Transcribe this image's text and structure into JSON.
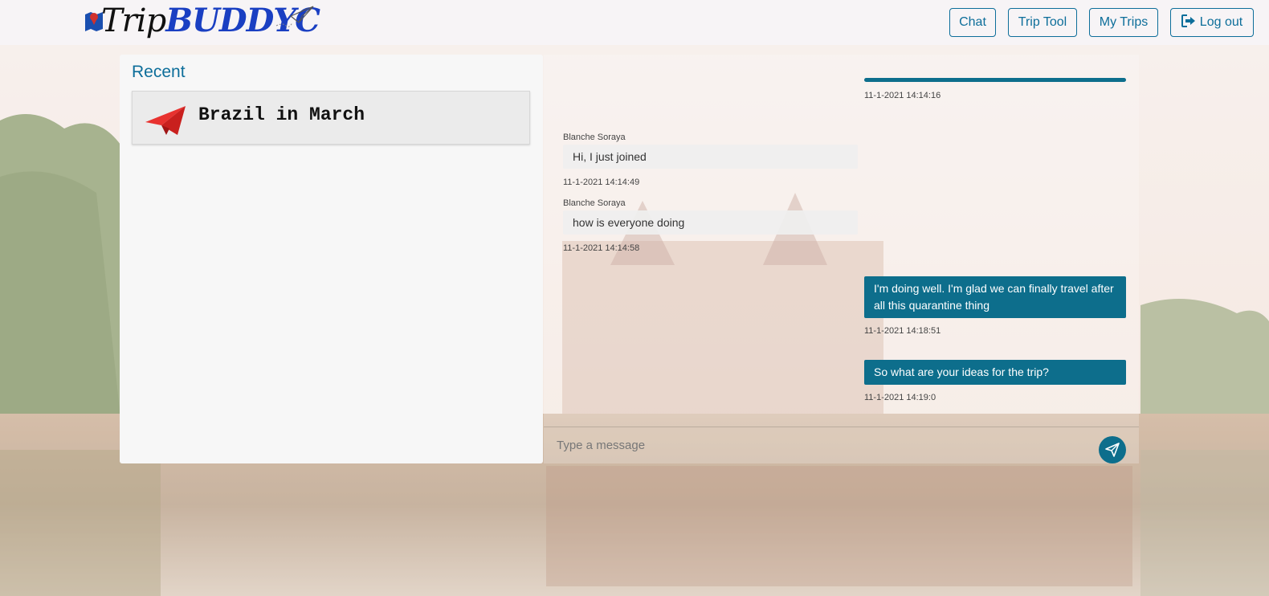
{
  "brand": {
    "part1": "Trip",
    "part2": "BUDDYC"
  },
  "nav": {
    "chat": "Chat",
    "trip_tool": "Trip Tool",
    "my_trips": "My Trips",
    "log_out": "Log out"
  },
  "sidebar": {
    "title": "Recent",
    "trips": [
      {
        "name": "Brazil in March",
        "icon": "paper-plane-icon"
      }
    ]
  },
  "chat": {
    "messages": [
      {
        "direction": "out",
        "sender": "",
        "text": "",
        "time": "11-1-2021 14:14:16"
      },
      {
        "direction": "in",
        "sender": "Blanche Soraya",
        "text": "Hi, I just joined",
        "time": "11-1-2021 14:14:49"
      },
      {
        "direction": "in",
        "sender": "Blanche Soraya",
        "text": "how is everyone doing",
        "time": "11-1-2021 14:14:58"
      },
      {
        "direction": "out",
        "sender": "",
        "text": "I'm doing well. I'm glad we can finally travel after all this quarantine thing",
        "time": "11-1-2021 14:18:51"
      },
      {
        "direction": "out",
        "sender": "",
        "text": "So what are your ideas for the trip?",
        "time": "11-1-2021 14:19:0"
      }
    ],
    "composer": {
      "placeholder": "Type a message",
      "value": ""
    }
  },
  "colors": {
    "accent": "#0d6e8c",
    "brand_blue": "#1a3fc2",
    "plane_red": "#e8322f"
  }
}
